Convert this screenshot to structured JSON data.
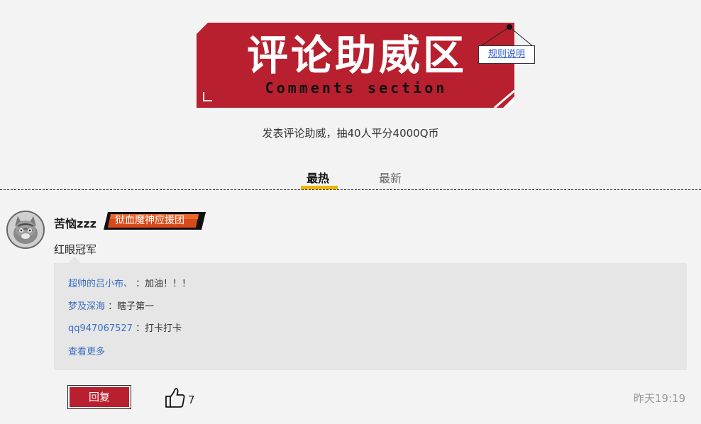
{
  "banner": {
    "title": "评论助威区",
    "subtitle": "Comments section",
    "rules_link": "规则说明",
    "color": "#b8202f"
  },
  "subtitle": "发表评论助威，抽40人平分4000Q币",
  "tabs": [
    {
      "label": "最热",
      "active": true
    },
    {
      "label": "最新",
      "active": false
    }
  ],
  "accent_color": "#f0b400",
  "comment": {
    "username": "苦恼zzz",
    "badge": "狱血魔神应援团",
    "text": "红眼冠军",
    "replies": [
      {
        "name": "超帅的吕小布、",
        "text": "：加油！！！"
      },
      {
        "name": "梦及深海",
        "text": "：瞎子第一"
      },
      {
        "name": "qq947067527",
        "text": "：打卡打卡"
      }
    ],
    "view_more": "查看更多",
    "reply_button": "回复",
    "like_count": "7",
    "timestamp": "昨天19:19"
  }
}
